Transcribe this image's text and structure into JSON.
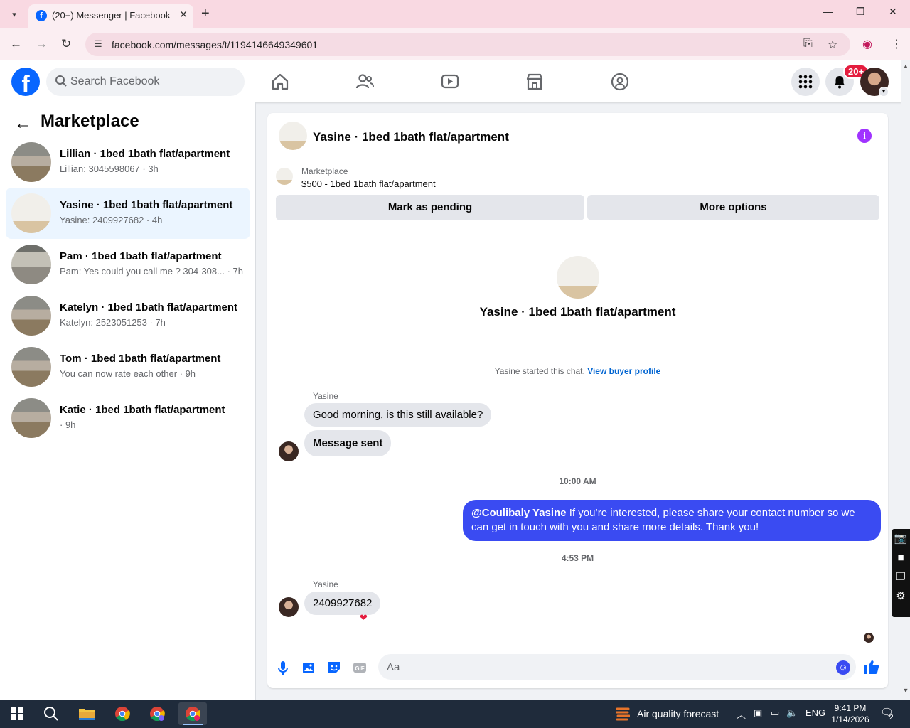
{
  "browser": {
    "tab_title": "(20+) Messenger | Facebook",
    "url": "facebook.com/messages/t/1194146649349601",
    "icons": [
      "tab-search-icon",
      "close-icon",
      "plus-icon",
      "minimize-icon",
      "restore-icon",
      "back-arrow-icon",
      "forward-arrow-icon",
      "reload-icon",
      "site-info-icon",
      "install-app-icon",
      "star-icon",
      "profile-icon",
      "kebab-menu-icon"
    ]
  },
  "fb_header": {
    "search_placeholder": "Search Facebook",
    "notifications_badge": "20+",
    "nav_icons": [
      "home-icon",
      "friends-icon",
      "watch-icon",
      "marketplace-icon",
      "groups-icon"
    ],
    "accent_color": "#0866ff"
  },
  "sidebar": {
    "title": "Marketplace",
    "conversations": [
      {
        "name": "Lillian · 1bed 1bath flat/apartment",
        "snippet": "Lillian: 3045598067 · 3h",
        "active": false
      },
      {
        "name": "Yasine · 1bed 1bath flat/apartment",
        "snippet": "Yasine: 2409927682 · 4h",
        "active": true
      },
      {
        "name": "Pam · 1bed 1bath flat/apartment",
        "snippet": "Pam: Yes could you call me ? 304-308... · 7h",
        "active": false
      },
      {
        "name": "Katelyn · 1bed 1bath flat/apartment",
        "snippet": "Katelyn: 2523051253 · 7h",
        "active": false
      },
      {
        "name": "Tom · 1bed 1bath flat/apartment",
        "snippet": "You can now rate each other · 9h",
        "active": false
      },
      {
        "name": "Katie · 1bed 1bath flat/apartment",
        "snippet": " · 9h",
        "active": false
      }
    ]
  },
  "chat": {
    "title": "Yasine · 1bed 1bath flat/apartment",
    "marketplace_label": "Marketplace",
    "listing": "$500 - 1bed 1bath flat/apartment",
    "mark_pending": "Mark as pending",
    "more_options": "More options",
    "intro_name": "Yasine · 1bed 1bath flat/apartment",
    "started_text": "Yasine started this chat.",
    "view_profile": "View buyer profile",
    "messages": {
      "sender1": "Yasine",
      "msg1": "Good morning, is this still available?",
      "msg2": "Message sent",
      "time1": "10:00 AM",
      "out_mention": "@Coulibaly Yasine",
      "out_text": " If you’re interested, please share your contact number so we can get in touch with you and share more details. Thank you!",
      "time2": "4:53 PM",
      "sender2": "Yasine",
      "msg3": "2409927682",
      "reaction": "❤"
    },
    "composer_placeholder": "Aa",
    "outgoing_color": "#3a4bf2"
  },
  "taskbar": {
    "weather": "Air quality forecast",
    "language": "ENG",
    "time": "9:41 PM",
    "date": "1/14/2026",
    "notification_count": "2"
  }
}
